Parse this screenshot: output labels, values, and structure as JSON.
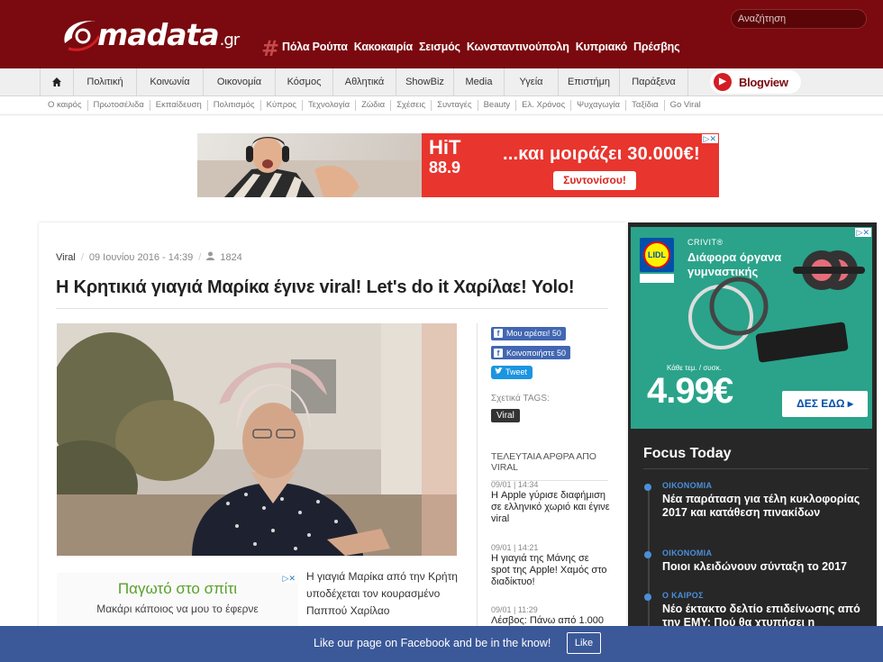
{
  "header": {
    "logo_text": "madata",
    "logo_suffix": ".gr",
    "hashtag": "#",
    "hot_links": [
      "Πόλα Ρούπα",
      "Κακοκαιρία",
      "Σεισμός",
      "Κωνσταντινούπολη",
      "Κυπριακό",
      "Πρέσβης"
    ],
    "search_placeholder": "Αναζήτηση"
  },
  "nav": {
    "items": [
      "Πολιτική",
      "Κοινωνία",
      "Οικονομία",
      "Κόσμος",
      "Αθλητικά",
      "ShowBiz",
      "Media",
      "Υγεία",
      "Επιστήμη",
      "Παράξενα"
    ],
    "blogview": "Blogview"
  },
  "subnav": [
    "Ο καιρός",
    "Πρωτοσέλιδα",
    "Εκπαίδευση",
    "Πολιτισμός",
    "Κύπρος",
    "Τεχνολογία",
    "Ζώδια",
    "Σχέσεις",
    "Συνταγές",
    "Beauty",
    "Ελ. Χρόνος",
    "Ψυχαγωγία",
    "Ταξίδια",
    "Go Viral"
  ],
  "banner": {
    "brand": "HiT 88.9",
    "brand_line1": "HiT",
    "brand_line2": "88.9",
    "headline": "...και μοιράζει 30.000€!",
    "button": "Συντονίσου!"
  },
  "article": {
    "category": "Viral",
    "date": "09 Ιουνίου 2016 - 14:39",
    "views": "1824",
    "title": "Η Κρητικιά γιαγιά Μαρίκα έγινε viral! Let's do it Χαρίλαε! Yolo!",
    "body": "Η γιαγιά Μαρίκα από την Κρήτη υποδέχεται τον κουρασμένο Παππού Χαρίλαο"
  },
  "inner_ad": {
    "title": "Παγωτό στο σπίτι",
    "subtitle": "Μακάρι κάποιος να μου το έφερνε"
  },
  "social": {
    "fb_like": "Μου αρέσει! 50",
    "fb_share": "Κοινοποιήστε 50",
    "tweet": "Tweet"
  },
  "tags": {
    "label": "Σχετικά TAGS:",
    "items": [
      "Viral"
    ]
  },
  "latest": {
    "title": "ΤΕΛΕΥΤΑΙΑ ΑΡΘΡΑ ΑΠΟ VIRAL",
    "items": [
      {
        "date": "09/01 | 14:34",
        "title": "Η Apple γύρισε διαφήμιση σε ελληνικό χωριό και έγινε viral"
      },
      {
        "date": "09/01 | 14:21",
        "title": "Η γιαγιά της Μάνης σε spot της Apple! Χαμός στο διαδίκτυο!"
      },
      {
        "date": "09/01 | 11:29",
        "title": "Λέσβος: Πάνω από 1.000"
      }
    ]
  },
  "side_ad": {
    "brand": "LIDL",
    "crivit": "CRIVIT®",
    "headline": "Διάφορα όργανα γυμναστικής",
    "small": "Κάθε τεμ. / συσκ.",
    "price": "4.99€",
    "button": "ΔΕΣ ΕΔΩ ▸"
  },
  "focus": {
    "title": "Focus Today",
    "items": [
      {
        "category": "ΟΙΚΟΝΟΜΙΑ",
        "title": "Νέα παράταση για τέλη κυκλοφορίας 2017 και κατάθεση πινακίδων"
      },
      {
        "category": "ΟΙΚΟΝΟΜΙΑ",
        "title": "Ποιοι κλειδώνουν σύνταξη το 2017"
      },
      {
        "category": "Ο ΚΑΙΡΟΣ",
        "title": "Νέο έκτακτο δελτίο επιδείνωσης από την ΕΜΥ: Πού θα χτυπήσει η"
      }
    ]
  },
  "fb_bar": {
    "text": "Like our page on Facebook and be in the know!",
    "button": "Like"
  },
  "colors": {
    "brand_red": "#7a0a0f",
    "facebook_blue": "#3b5998",
    "focus_blue": "#4a90d9"
  }
}
